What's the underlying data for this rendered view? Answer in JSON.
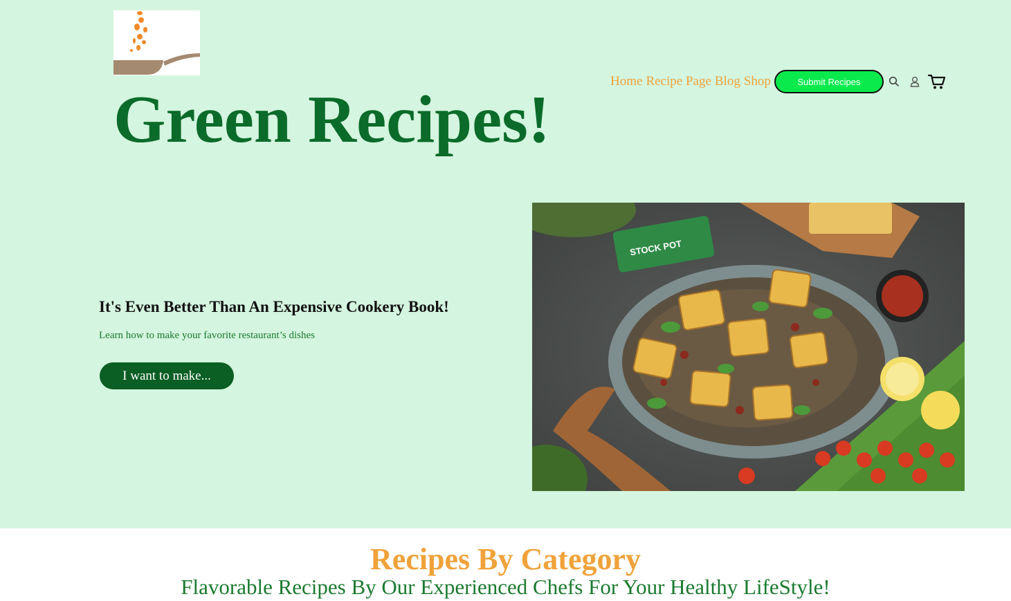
{
  "header": {
    "site_title": "Green Recipes!",
    "nav": [
      {
        "label": "Home"
      },
      {
        "label": "Recipe Page"
      },
      {
        "label": "Blog"
      },
      {
        "label": "Shop"
      }
    ],
    "submit_button": "Submit Recipes",
    "icons": [
      "search-icon",
      "account-icon",
      "cart-icon"
    ]
  },
  "hero": {
    "heading": "It's Even Better Than An Expensive Cookery Book!",
    "subheading": "Learn how to make your favorite restaurant’s dishes",
    "cta": "I want to make...",
    "image_label": "STOCK POT"
  },
  "categories": {
    "title": "Recipes By Category",
    "subtitle": "Flavorable Recipes By Our Experienced Chefs For Your Healthy LifeStyle!"
  },
  "colors": {
    "hero_bg": "#d4f5df",
    "title_green": "#0b6b2a",
    "nav_orange": "#f0a23a",
    "submit_green": "#0aea4d",
    "cta_green": "#0b5e24"
  }
}
